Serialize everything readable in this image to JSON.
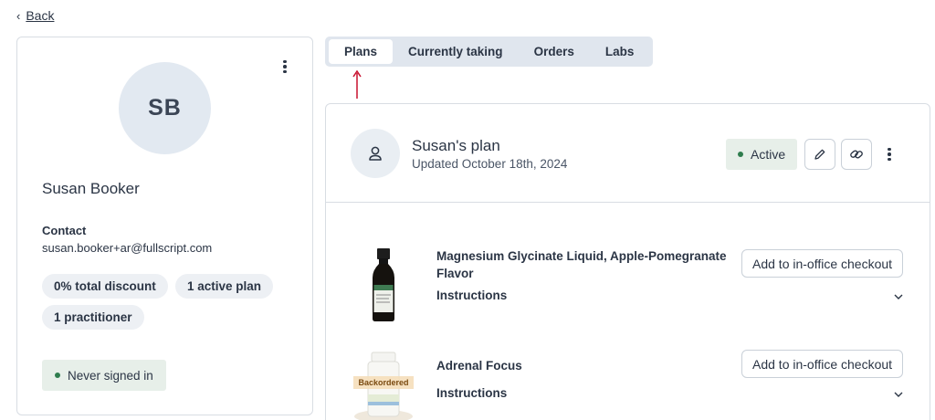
{
  "nav": {
    "back_label": "Back",
    "back_icon": "chevron-left-icon"
  },
  "patient": {
    "initials": "SB",
    "name": "Susan Booker",
    "contact_heading": "Contact",
    "email": "susan.booker+ar@fullscript.com",
    "badges": [
      "0% total discount",
      "1 active plan",
      "1 practitioner"
    ],
    "signin_status": "Never signed in"
  },
  "tabs": [
    {
      "label": "Plans",
      "active": true
    },
    {
      "label": "Currently taking",
      "active": false
    },
    {
      "label": "Orders",
      "active": false
    },
    {
      "label": "Labs",
      "active": false
    }
  ],
  "plan": {
    "title": "Susan's plan",
    "updated": "Updated October 18th, 2024",
    "status": "Active",
    "products": [
      {
        "name": "Magnesium Glycinate Liquid, Apple-Pomegranate Flavor",
        "instructions_label": "Instructions",
        "action_label": "Add to in-office checkout"
      },
      {
        "name": "Adrenal Focus",
        "instructions_label": "Instructions",
        "action_label": "Add to in-office checkout",
        "image_badge": "Backordered"
      }
    ]
  },
  "colors": {
    "text": "#2b3545",
    "status_green": "#2f7d4e",
    "status_bg": "#e7efe9",
    "annotation_arrow": "#c8102e",
    "tab_bg": "#e0e6ee"
  }
}
